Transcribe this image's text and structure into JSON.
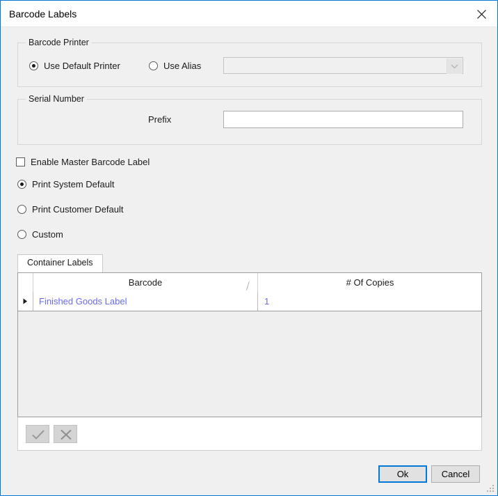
{
  "window": {
    "title": "Barcode Labels",
    "close_icon": "close-icon",
    "accent_color": "#0078d7",
    "body_background": "#f0f0f0"
  },
  "printer_group": {
    "title": "Barcode Printer",
    "options": [
      {
        "label": "Use Default Printer",
        "checked": true
      },
      {
        "label": "Use Alias",
        "checked": false
      }
    ],
    "alias_combo": {
      "value": "",
      "placeholder": "",
      "enabled": false,
      "arrow_icon": "chevron-down-icon"
    }
  },
  "serial_group": {
    "title": "Serial Number",
    "prefix_label": "Prefix",
    "prefix_value": "",
    "prefix_placeholder": ""
  },
  "master_label": {
    "checkbox_label": "Enable Master Barcode Label",
    "checkbox_checked": false,
    "radios": [
      {
        "label": "Print System Default",
        "checked": true
      },
      {
        "label": "Print Customer Default",
        "checked": false
      },
      {
        "label": "Custom",
        "checked": false
      }
    ]
  },
  "tabs": [
    {
      "label": "Container Labels",
      "active": true
    }
  ],
  "grid": {
    "columns": [
      {
        "label": "Barcode",
        "sort_indicator": "╱"
      },
      {
        "label": "# Of Copies",
        "sort_indicator": ""
      }
    ],
    "rows": [
      {
        "marker": "current-row-arrow",
        "barcode": "Finished Goods Label",
        "copies": "1"
      }
    ],
    "row_text_color": "#6a6af0",
    "toolbar": [
      {
        "name": "accept-button",
        "icon": "check-icon",
        "enabled": false
      },
      {
        "name": "reject-button",
        "icon": "x-icon",
        "enabled": false
      }
    ]
  },
  "footer": {
    "ok_label": "Ok",
    "cancel_label": "Cancel",
    "default_button": "Ok",
    "resize_grip": "resize-grip"
  }
}
